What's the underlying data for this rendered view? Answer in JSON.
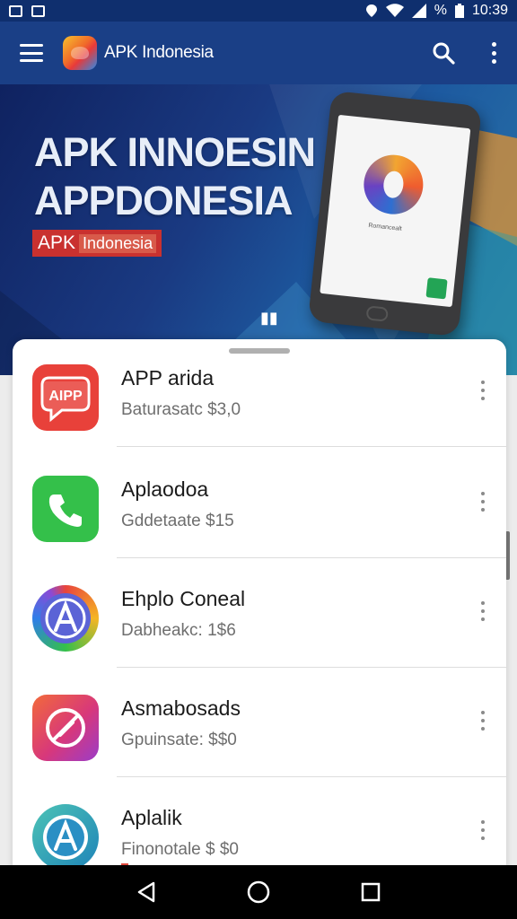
{
  "status_bar": {
    "battery_percent": "%",
    "time": "10:39"
  },
  "app_bar": {
    "title": "APK Indonesia",
    "icons": [
      "menu-icon",
      "app-logo",
      "search-icon",
      "more-vert-icon"
    ]
  },
  "hero": {
    "line1": "APK INNOESIN",
    "line2": "APPDONESIA",
    "tag_main": "APK",
    "tag_sub": "Indonesia",
    "phone_caption": "Romancealt"
  },
  "apps": [
    {
      "name": "APP arida",
      "price": "Baturasatc $3,0",
      "icon": "apk-badge-icon",
      "icon_text": "AIPP",
      "color": "#e8413a"
    },
    {
      "name": "Aplaodoa",
      "price": "Gddetaate $15",
      "icon": "phone-icon",
      "color": "#34c04a"
    },
    {
      "name": "Ehplo Coneal",
      "price": "Dabheakc: 1$6",
      "icon": "app-store-a-icon",
      "color": "#5b63d6"
    },
    {
      "name": "Asmabosads",
      "price": "Gpuinsate: $$0",
      "icon": "compass-icon",
      "color": "#d8387a"
    },
    {
      "name": "Aplalik",
      "price": "Finonotale $ $0",
      "extra": "sgmaomaa",
      "icon": "app-store-a-icon",
      "color": "#1f84b8"
    }
  ],
  "nav_bar": {
    "buttons": [
      "back-icon",
      "home-icon",
      "recents-icon"
    ]
  }
}
